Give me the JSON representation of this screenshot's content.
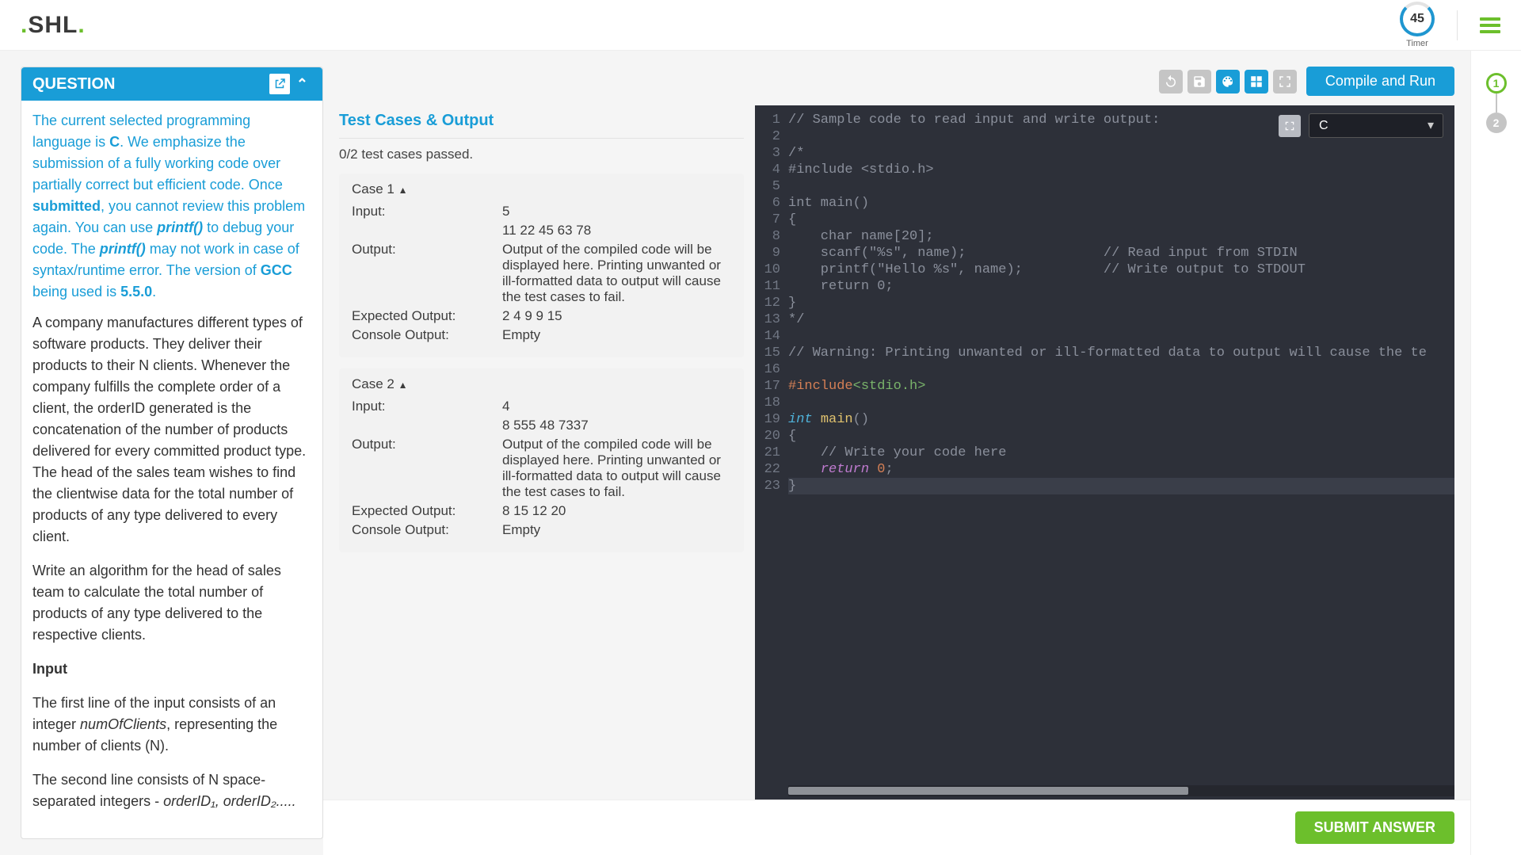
{
  "header": {
    "brand_pre_dot": ".",
    "brand_text": "SHL",
    "brand_post_dot": ".",
    "timer_value": "45",
    "timer_label": "Timer"
  },
  "toolbar": {
    "compile_label": "Compile and Run"
  },
  "question": {
    "header": "QUESTION",
    "intro_html": "The current selected programming language is <b>C</b>. We emphasize the submission of a fully working code over partially correct but efficient code. Once <b>submitted</b>, you cannot review this problem again. You can use <span class='fn'>printf()</span> to debug your code. The <span class='fn'>printf()</span> may not work in case of syntax/runtime error. The version of <b>GCC</b> being used is <b>5.5.0</b>.",
    "desc_p1": "A company manufactures different types of software products. They deliver their products to their N clients. Whenever the company fulfills the complete order of a client, the orderID generated is the concatenation of the number of products delivered for every committed product type. The head of the sales team wishes to find the clientwise data for the total number of products of any type delivered to every client.",
    "desc_p2": "Write an algorithm for the head of sales team to calculate the total number of products of any type delivered to the respective clients.",
    "input_title": "Input",
    "input_l1_pre": "The first line of the input consists of an integer ",
    "input_l1_em": "numOfClients",
    "input_l1_post": ", representing the number of clients (N).",
    "input_l2_pre": "The second line consists of N space-separated integers - ",
    "input_l2_em": "orderID₁, orderID₂.....",
    "input_l2_post": ""
  },
  "tests": {
    "title": "Test Cases & Output",
    "summary": "0/2 test cases passed.",
    "cases": [
      {
        "name": "Case 1",
        "input_l1": "5",
        "input_l2": "11 22 45 63 78",
        "output_msg": "Output of the compiled code will be displayed here. Printing unwanted or ill-formatted data to output will cause the test cases to fail.",
        "expected": "2 4 9 9 15",
        "console": "Empty"
      },
      {
        "name": "Case 2",
        "input_l1": "4",
        "input_l2": "8 555 48 7337",
        "output_msg": "Output of the compiled code will be displayed here. Printing unwanted or ill-formatted data to output will cause the test cases to fail.",
        "expected": "8 15 12 20",
        "console": "Empty"
      }
    ],
    "labels": {
      "input": "Input:",
      "output": "Output:",
      "expected": "Expected Output:",
      "console": "Console Output:"
    }
  },
  "editor": {
    "language": "C",
    "lines": [
      "// Sample code to read input and write output:",
      "",
      "/*",
      "#include <stdio.h>",
      "",
      "int main()",
      "{",
      "    char name[20];",
      "    scanf(\"%s\", name);                 // Read input from STDIN",
      "    printf(\"Hello %s\", name);          // Write output to STDOUT",
      "    return 0;",
      "}",
      "*/",
      "",
      "// Warning: Printing unwanted or ill-formatted data to output will cause the te",
      "",
      "#include<stdio.h>",
      "",
      "int main()",
      "{",
      "    // Write your code here",
      "    return 0;",
      "}"
    ]
  },
  "footer": {
    "submit_label": "SUBMIT ANSWER"
  },
  "rail": {
    "steps": [
      "1",
      "2"
    ]
  }
}
